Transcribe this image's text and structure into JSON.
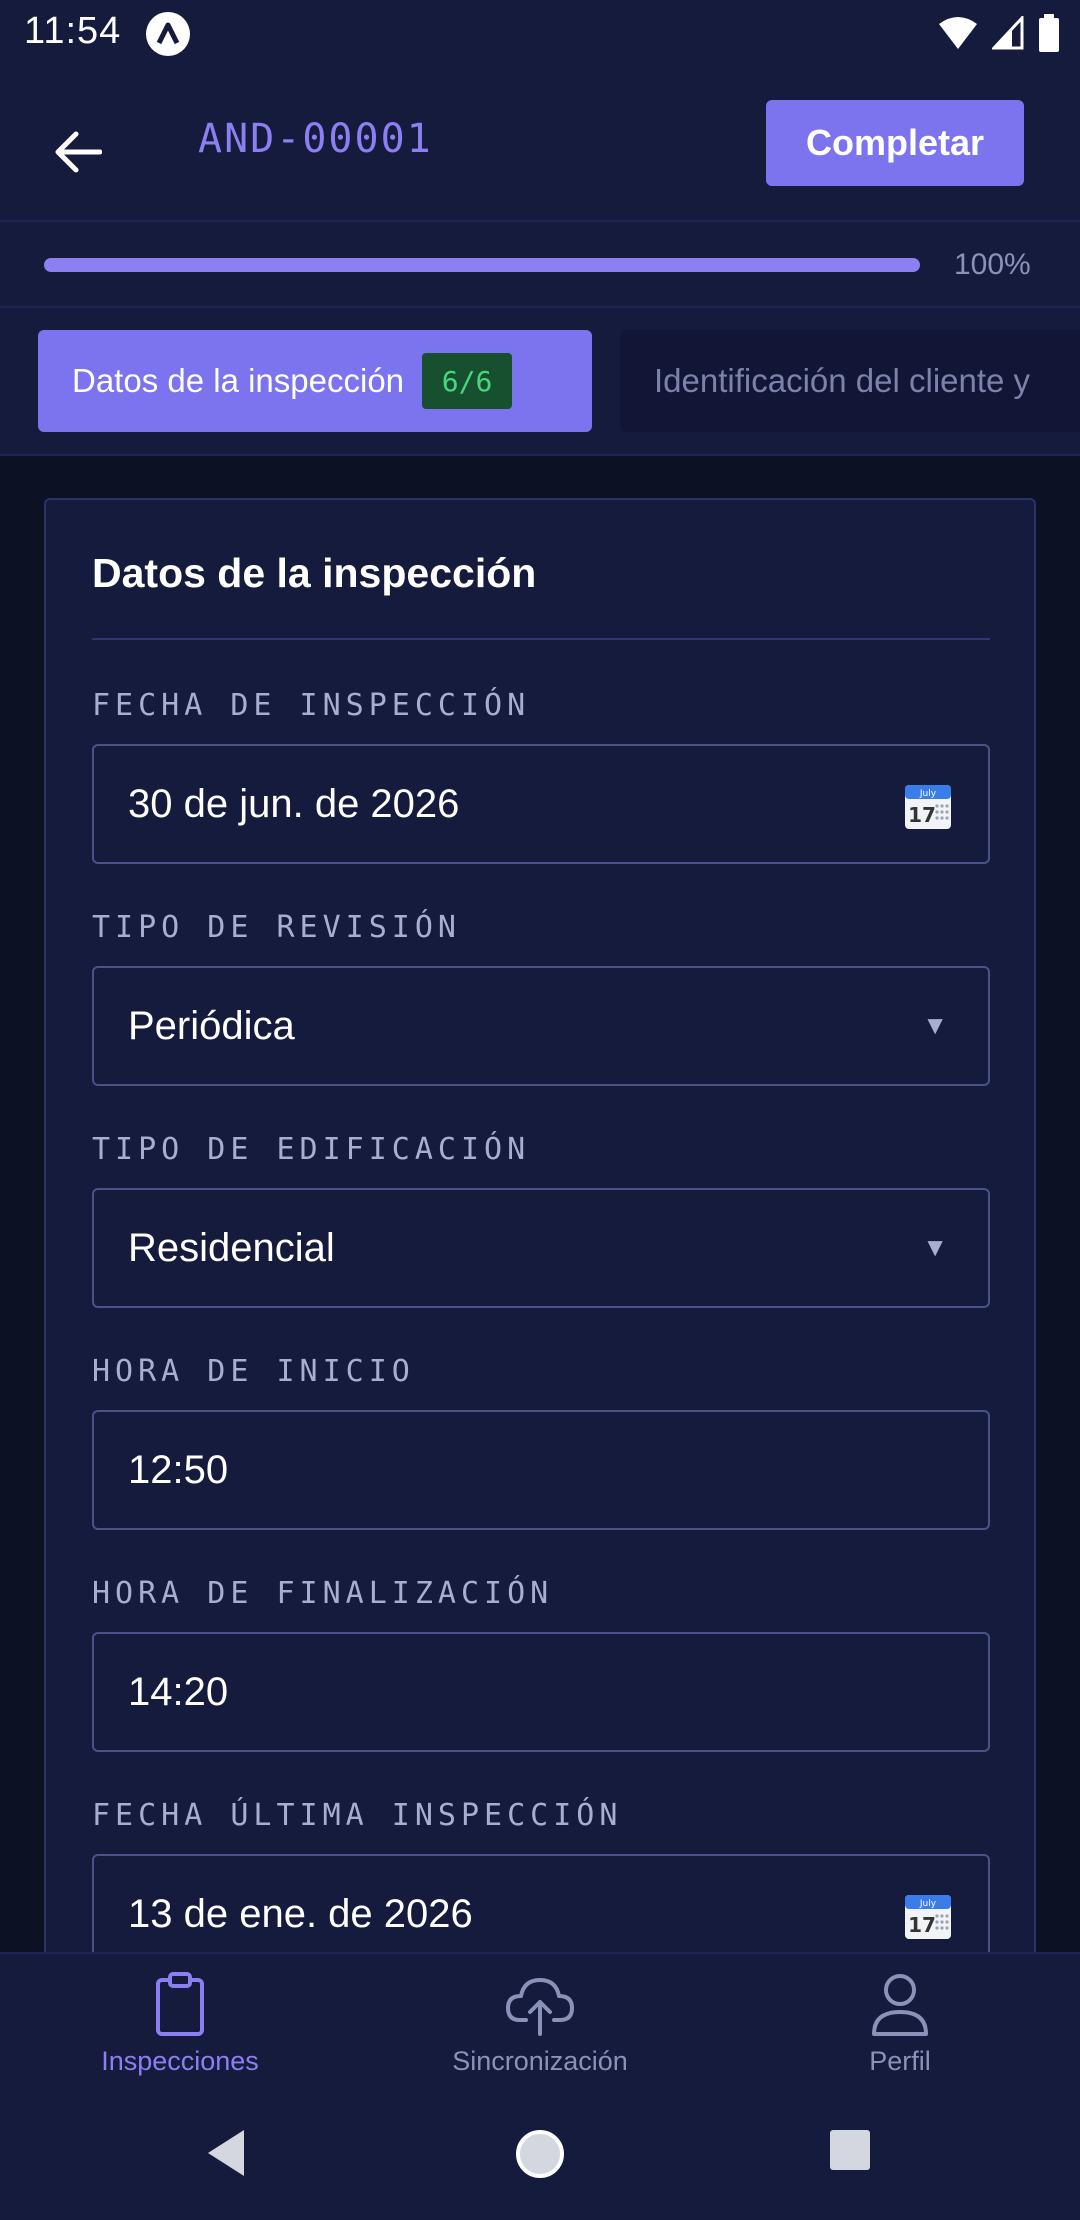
{
  "status_bar": {
    "time": "11:54"
  },
  "header": {
    "title": "AND-00001",
    "complete_label": "Completar"
  },
  "progress": {
    "value_percent": 100,
    "label": "100%"
  },
  "tabs": [
    {
      "label": "Datos de la inspección",
      "badge": "6/6",
      "active": true
    },
    {
      "label": "Identificación del cliente y",
      "active": false
    }
  ],
  "form": {
    "title": "Datos de la inspección",
    "fields": [
      {
        "label": "FECHA DE INSPECCIÓN",
        "value": "30 de jun. de 2026",
        "control": "date",
        "icon": "calendar-icon"
      },
      {
        "label": "TIPO DE REVISIÓN",
        "value": "Periódica",
        "control": "select",
        "arrow": "▼"
      },
      {
        "label": "TIPO DE EDIFICACIÓN",
        "value": "Residencial",
        "control": "select",
        "arrow": "▼"
      },
      {
        "label": "HORA DE INICIO",
        "value": "12:50",
        "control": "text"
      },
      {
        "label": "HORA DE FINALIZACIÓN",
        "value": "14:20",
        "control": "text"
      },
      {
        "label": "FECHA ÚLTIMA INSPECCIÓN",
        "value": "13 de ene. de 2026",
        "control": "date",
        "icon": "calendar-icon"
      }
    ]
  },
  "bottom_nav": [
    {
      "label": "Inspecciones",
      "icon": "clipboard-icon",
      "active": true
    },
    {
      "label": "Sincronización",
      "icon": "cloud-upload-icon",
      "active": false
    },
    {
      "label": "Perfil",
      "icon": "user-icon",
      "active": false
    }
  ],
  "colors": {
    "accent": "#7c74ee",
    "background": "#0d1124",
    "surface": "#151b3d",
    "badge_bg": "#16502e",
    "badge_text": "#47d67e"
  }
}
